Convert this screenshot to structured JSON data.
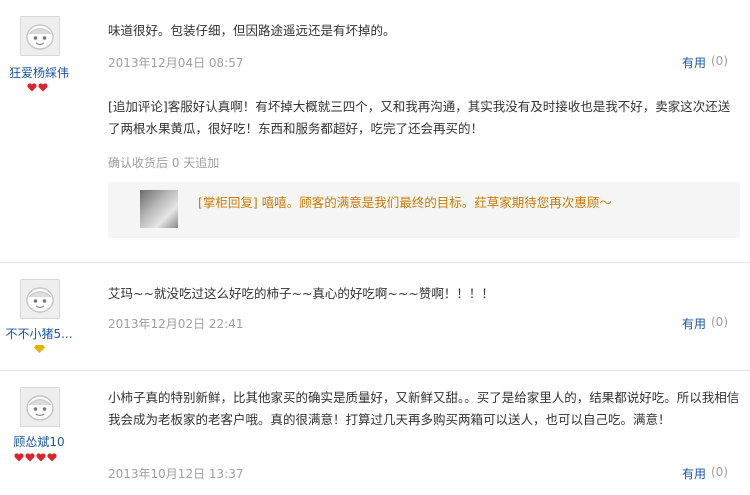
{
  "reviews": [
    {
      "user": "狂爱杨綵伟",
      "text": "味道很好。包装仔细，但因路途遥远还是有坏掉的。",
      "date": "2013年12月04日 08:57",
      "useful_label": "有用",
      "useful_count": "(0)",
      "badge_level": 2,
      "followup": {
        "text": "[追加评论]客服好认真啊！有坏掉大概就三四个，又和我再沟通，其实我没有及时接收也是我不好，卖家这次还送了两根水果黄瓜，很好吃！东西和服务都超好，吃完了还会再买的！",
        "confirm": "确认收货后 0 天追加"
      },
      "reply": {
        "text": "[掌柜回复] 嘻嘻。顾客的满意是我们最终的目标。荭草家期待您再次惠顾～"
      }
    },
    {
      "user": "不不小猪5...",
      "text": "艾玛~~就没吃过这么好吃的柿子~~真心的好吃啊~~~赞啊！！！！",
      "date": "2013年12月02日 22:41",
      "useful_label": "有用",
      "useful_count": "(0)",
      "badge_level": 1
    },
    {
      "user": "顾怂斌10",
      "text": "小柿子真的特别新鲜，比其他家买的确实是质量好，又新鲜又甜。。买了是给家里人的，结果都说好吃。所以我相信我会成为老板家的老客户哦。真的很满意！打算过几天再多购买两箱可以送人，也可以自己吃。满意！",
      "date": "2013年10月12日 13:37",
      "useful_label": "有用",
      "useful_count": "(0)",
      "badge_level": 4
    }
  ],
  "colors": {
    "link": "#1a56a6",
    "meta": "#a0a0a0",
    "reply": "#cc7a00",
    "heart": "#d9262a",
    "diamond": "#e8b200"
  },
  "icons": {
    "avatar": "default-avatar-icon",
    "heart": "heart-badge-icon",
    "diamond": "diamond-badge-icon"
  }
}
